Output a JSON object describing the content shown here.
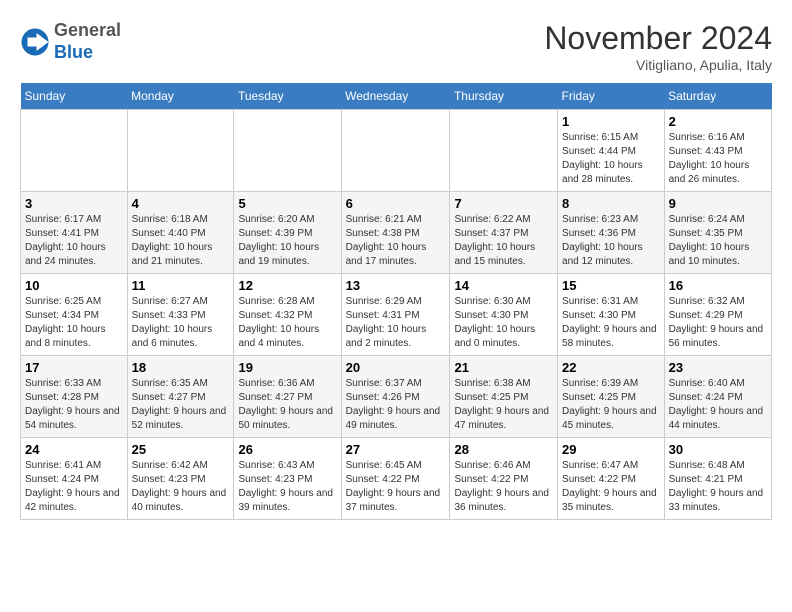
{
  "logo": {
    "general": "General",
    "blue": "Blue"
  },
  "title": "November 2024",
  "location": "Vitigliano, Apulia, Italy",
  "days_of_week": [
    "Sunday",
    "Monday",
    "Tuesday",
    "Wednesday",
    "Thursday",
    "Friday",
    "Saturday"
  ],
  "weeks": [
    [
      {
        "day": "",
        "sunrise": "",
        "sunset": "",
        "daylight": ""
      },
      {
        "day": "",
        "sunrise": "",
        "sunset": "",
        "daylight": ""
      },
      {
        "day": "",
        "sunrise": "",
        "sunset": "",
        "daylight": ""
      },
      {
        "day": "",
        "sunrise": "",
        "sunset": "",
        "daylight": ""
      },
      {
        "day": "",
        "sunrise": "",
        "sunset": "",
        "daylight": ""
      },
      {
        "day": "1",
        "sunrise": "6:15 AM",
        "sunset": "4:44 PM",
        "daylight": "10 hours and 28 minutes."
      },
      {
        "day": "2",
        "sunrise": "6:16 AM",
        "sunset": "4:43 PM",
        "daylight": "10 hours and 26 minutes."
      }
    ],
    [
      {
        "day": "3",
        "sunrise": "6:17 AM",
        "sunset": "4:41 PM",
        "daylight": "10 hours and 24 minutes."
      },
      {
        "day": "4",
        "sunrise": "6:18 AM",
        "sunset": "4:40 PM",
        "daylight": "10 hours and 21 minutes."
      },
      {
        "day": "5",
        "sunrise": "6:20 AM",
        "sunset": "4:39 PM",
        "daylight": "10 hours and 19 minutes."
      },
      {
        "day": "6",
        "sunrise": "6:21 AM",
        "sunset": "4:38 PM",
        "daylight": "10 hours and 17 minutes."
      },
      {
        "day": "7",
        "sunrise": "6:22 AM",
        "sunset": "4:37 PM",
        "daylight": "10 hours and 15 minutes."
      },
      {
        "day": "8",
        "sunrise": "6:23 AM",
        "sunset": "4:36 PM",
        "daylight": "10 hours and 12 minutes."
      },
      {
        "day": "9",
        "sunrise": "6:24 AM",
        "sunset": "4:35 PM",
        "daylight": "10 hours and 10 minutes."
      }
    ],
    [
      {
        "day": "10",
        "sunrise": "6:25 AM",
        "sunset": "4:34 PM",
        "daylight": "10 hours and 8 minutes."
      },
      {
        "day": "11",
        "sunrise": "6:27 AM",
        "sunset": "4:33 PM",
        "daylight": "10 hours and 6 minutes."
      },
      {
        "day": "12",
        "sunrise": "6:28 AM",
        "sunset": "4:32 PM",
        "daylight": "10 hours and 4 minutes."
      },
      {
        "day": "13",
        "sunrise": "6:29 AM",
        "sunset": "4:31 PM",
        "daylight": "10 hours and 2 minutes."
      },
      {
        "day": "14",
        "sunrise": "6:30 AM",
        "sunset": "4:30 PM",
        "daylight": "10 hours and 0 minutes."
      },
      {
        "day": "15",
        "sunrise": "6:31 AM",
        "sunset": "4:30 PM",
        "daylight": "9 hours and 58 minutes."
      },
      {
        "day": "16",
        "sunrise": "6:32 AM",
        "sunset": "4:29 PM",
        "daylight": "9 hours and 56 minutes."
      }
    ],
    [
      {
        "day": "17",
        "sunrise": "6:33 AM",
        "sunset": "4:28 PM",
        "daylight": "9 hours and 54 minutes."
      },
      {
        "day": "18",
        "sunrise": "6:35 AM",
        "sunset": "4:27 PM",
        "daylight": "9 hours and 52 minutes."
      },
      {
        "day": "19",
        "sunrise": "6:36 AM",
        "sunset": "4:27 PM",
        "daylight": "9 hours and 50 minutes."
      },
      {
        "day": "20",
        "sunrise": "6:37 AM",
        "sunset": "4:26 PM",
        "daylight": "9 hours and 49 minutes."
      },
      {
        "day": "21",
        "sunrise": "6:38 AM",
        "sunset": "4:25 PM",
        "daylight": "9 hours and 47 minutes."
      },
      {
        "day": "22",
        "sunrise": "6:39 AM",
        "sunset": "4:25 PM",
        "daylight": "9 hours and 45 minutes."
      },
      {
        "day": "23",
        "sunrise": "6:40 AM",
        "sunset": "4:24 PM",
        "daylight": "9 hours and 44 minutes."
      }
    ],
    [
      {
        "day": "24",
        "sunrise": "6:41 AM",
        "sunset": "4:24 PM",
        "daylight": "9 hours and 42 minutes."
      },
      {
        "day": "25",
        "sunrise": "6:42 AM",
        "sunset": "4:23 PM",
        "daylight": "9 hours and 40 minutes."
      },
      {
        "day": "26",
        "sunrise": "6:43 AM",
        "sunset": "4:23 PM",
        "daylight": "9 hours and 39 minutes."
      },
      {
        "day": "27",
        "sunrise": "6:45 AM",
        "sunset": "4:22 PM",
        "daylight": "9 hours and 37 minutes."
      },
      {
        "day": "28",
        "sunrise": "6:46 AM",
        "sunset": "4:22 PM",
        "daylight": "9 hours and 36 minutes."
      },
      {
        "day": "29",
        "sunrise": "6:47 AM",
        "sunset": "4:22 PM",
        "daylight": "9 hours and 35 minutes."
      },
      {
        "day": "30",
        "sunrise": "6:48 AM",
        "sunset": "4:21 PM",
        "daylight": "9 hours and 33 minutes."
      }
    ]
  ]
}
